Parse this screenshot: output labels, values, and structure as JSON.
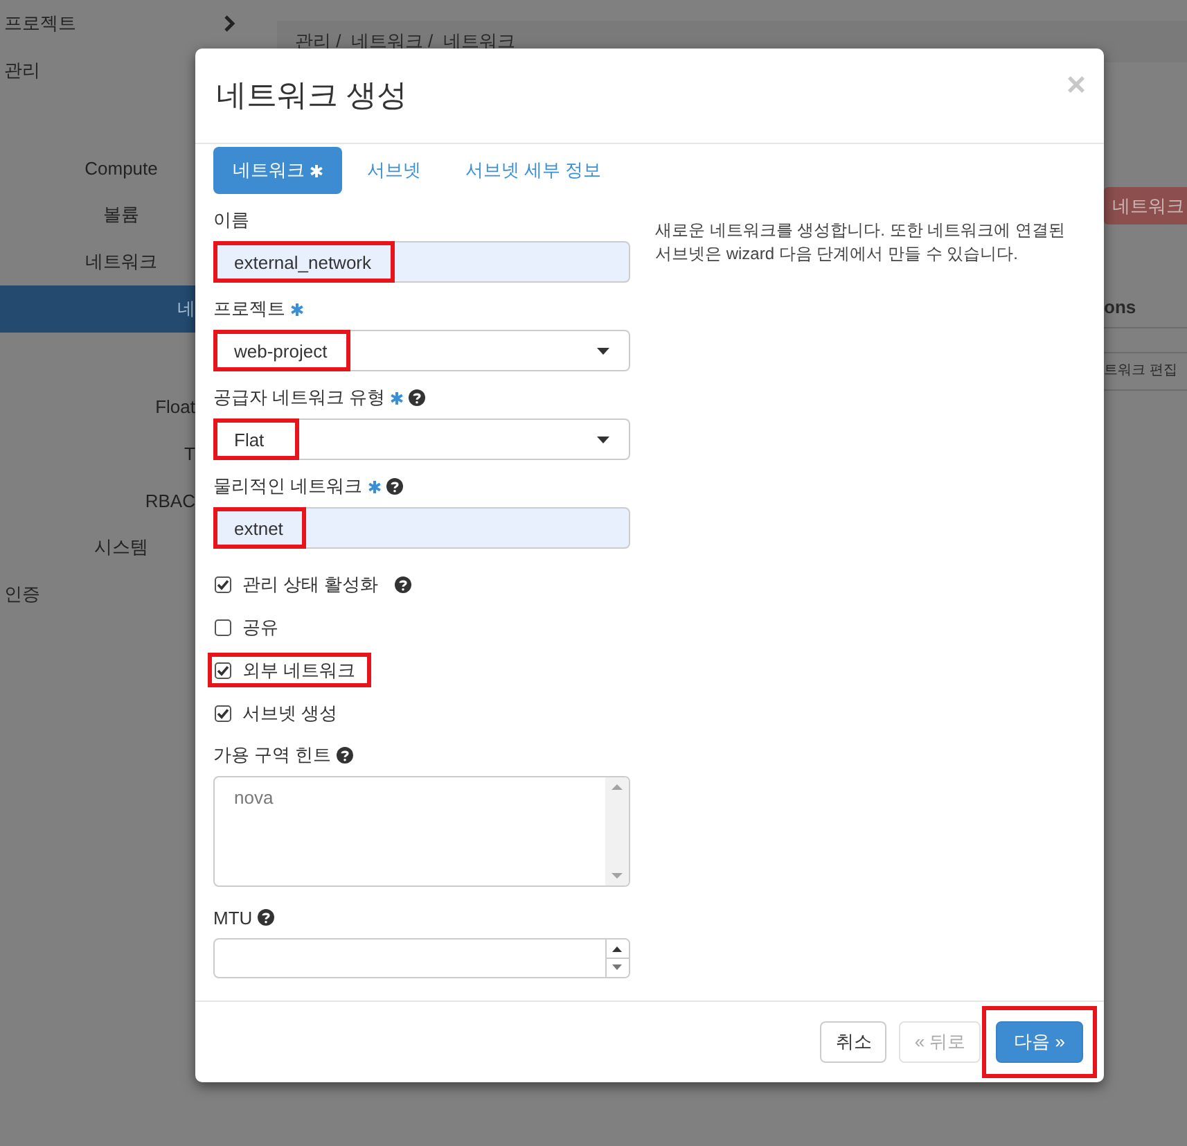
{
  "sidebar": {
    "items": [
      {
        "label": "프로젝트",
        "kind": "section",
        "selected": false,
        "expandable": true
      },
      {
        "label": "관리",
        "kind": "section",
        "selected": false
      },
      {
        "label": "Compute",
        "kind": "group",
        "selected": false
      },
      {
        "label": "볼륨",
        "kind": "group",
        "selected": false
      },
      {
        "label": "네트워크",
        "kind": "group",
        "selected": false
      },
      {
        "label": "네",
        "kind": "item",
        "selected": true
      },
      {
        "label": "Float",
        "kind": "item",
        "selected": false
      },
      {
        "label": "T",
        "kind": "item",
        "selected": false
      },
      {
        "label": "RBAC",
        "kind": "item",
        "selected": false
      },
      {
        "label": "시스템",
        "kind": "group",
        "selected": false
      },
      {
        "label": "인증",
        "kind": "section",
        "selected": false
      }
    ]
  },
  "breadcrumb": "관리 /  네트워크 /  네트워크",
  "background": {
    "action_button": "네트워크",
    "table_header": "ons",
    "row_action": "트워크 편집"
  },
  "modal": {
    "title": "네트워크 생성",
    "close": "×",
    "tabs": [
      {
        "label": "네트워크",
        "required": true,
        "selected": true
      },
      {
        "label": "서브넷",
        "required": false,
        "selected": false
      },
      {
        "label": "서브넷 세부 정보",
        "required": false,
        "selected": false
      }
    ],
    "fields": [
      {
        "kind": "text",
        "label": "이름",
        "required": false,
        "help": false,
        "value": "external_network",
        "autofilled": true,
        "highlighted": true
      },
      {
        "kind": "select",
        "label": "프로젝트",
        "required": true,
        "help": false,
        "value": "web-project",
        "highlighted": true
      },
      {
        "kind": "select",
        "label": "공급자 네트워크 유형",
        "required": true,
        "help": true,
        "value": "Flat",
        "highlighted": true
      },
      {
        "kind": "text",
        "label": "물리적인 네트워크",
        "required": true,
        "help": true,
        "value": "extnet",
        "autofilled": true,
        "highlighted": true
      },
      {
        "kind": "checkbox",
        "label": "관리 상태 활성화",
        "checked": true,
        "help": true,
        "highlighted": false
      },
      {
        "kind": "checkbox",
        "label": "공유",
        "checked": false,
        "help": false,
        "highlighted": false
      },
      {
        "kind": "checkbox",
        "label": "외부 네트워크",
        "checked": true,
        "help": false,
        "highlighted": true
      },
      {
        "kind": "checkbox",
        "label": "서브넷 생성",
        "checked": true,
        "help": false,
        "highlighted": false
      },
      {
        "kind": "listbox",
        "label": "가용 구역 힌트",
        "required": false,
        "help": true,
        "options": [
          "nova"
        ]
      },
      {
        "kind": "number",
        "label": "MTU",
        "required": false,
        "help": true
      }
    ],
    "description": "새로운 네트워크를 생성합니다. 또한 네트워크에 연결된 서브넷은 wizard 다음 단계에서 만들 수 있습니다.",
    "buttons": [
      {
        "label": "취소",
        "kind": "default",
        "disabled": false,
        "highlighted": false
      },
      {
        "label": "« 뒤로",
        "kind": "default",
        "disabled": true,
        "highlighted": false
      },
      {
        "label": "다음 »",
        "kind": "primary",
        "disabled": false,
        "highlighted": true
      }
    ]
  }
}
